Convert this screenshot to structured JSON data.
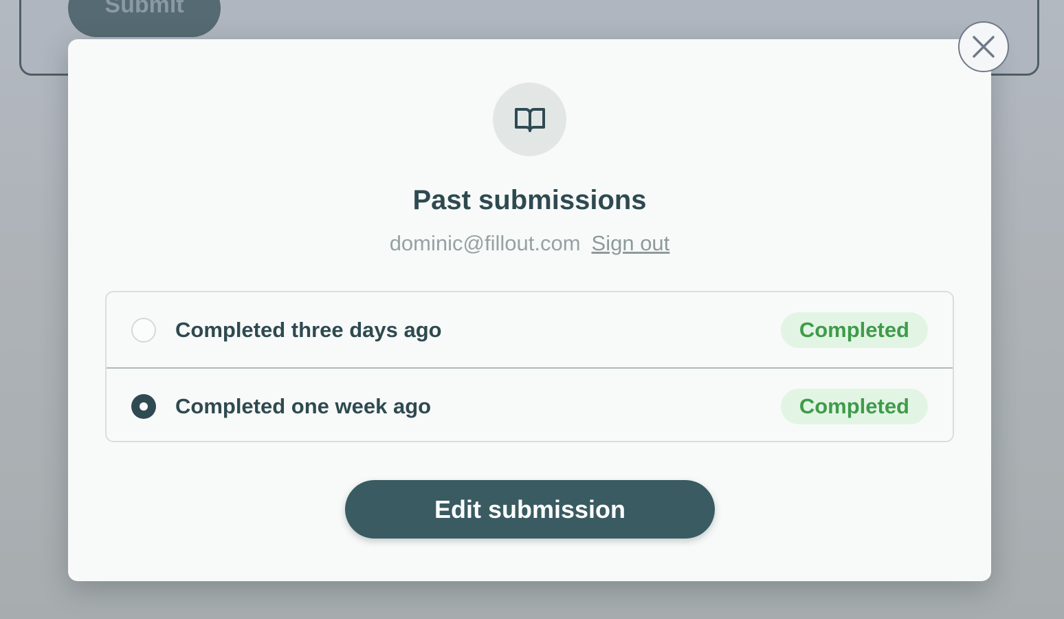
{
  "background": {
    "submit_label": "Submit"
  },
  "modal": {
    "icon": "book-open-icon",
    "title": "Past submissions",
    "email": "dominic@fillout.com",
    "sign_out_label": "Sign out",
    "submissions": [
      {
        "label": "Completed three days ago",
        "status": "Completed",
        "selected": false
      },
      {
        "label": "Completed one week ago",
        "status": "Completed",
        "selected": true
      }
    ],
    "edit_button_label": "Edit submission",
    "close_icon": "close-icon"
  },
  "colors": {
    "primary": "#395b61",
    "badge_bg": "#e2f5e4",
    "badge_text": "#3f9b4b"
  }
}
